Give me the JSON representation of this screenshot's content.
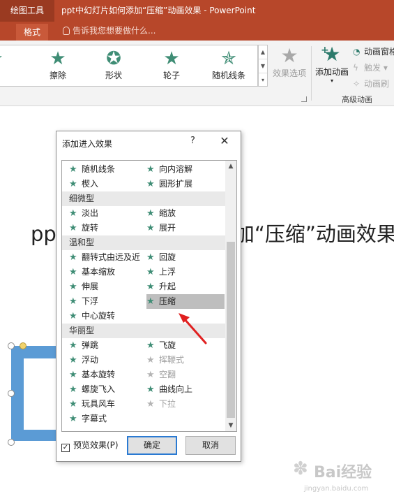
{
  "titlebar": {
    "tool_label": "绘图工具",
    "doc_title": "ppt中幻灯片如何添加“压缩”动画效果 - PowerPoint"
  },
  "tabs": {
    "format": "格式",
    "tell_me": "告诉我您想要做什么..."
  },
  "ribbon": {
    "gallery": [
      "裂",
      "擦除",
      "形状",
      "轮子",
      "随机线条"
    ],
    "effect_options": "效果选项",
    "add_animation": "添加动画",
    "animation_pane": "动画窗格",
    "trigger": "触发",
    "animation_painter": "动画刷",
    "group_label": "高级动画"
  },
  "slide": {
    "title_left": "pp",
    "title_right": "加“压缩”动画效果"
  },
  "dialog": {
    "title": "添加进入效果",
    "help": "?",
    "close": "✕",
    "rows": [
      {
        "type": "effects",
        "left": "随机线条",
        "right": "向内溶解"
      },
      {
        "type": "effects",
        "left": "楔入",
        "right": "圆形扩展"
      },
      {
        "type": "category",
        "label": "细微型"
      },
      {
        "type": "effects",
        "left": "淡出",
        "right": "缩放"
      },
      {
        "type": "effects",
        "left": "旋转",
        "right": "展开"
      },
      {
        "type": "category",
        "label": "温和型"
      },
      {
        "type": "effects",
        "left": "翻转式由远及近",
        "right": "回旋"
      },
      {
        "type": "effects",
        "left": "基本缩放",
        "right": "上浮"
      },
      {
        "type": "effects",
        "left": "伸展",
        "right": "升起"
      },
      {
        "type": "effects",
        "left": "下浮",
        "right": "压缩",
        "right_selected": true
      },
      {
        "type": "effects",
        "left": "中心旋转",
        "right": ""
      },
      {
        "type": "category",
        "label": "华丽型"
      },
      {
        "type": "effects",
        "left": "弹跳",
        "right": "飞旋"
      },
      {
        "type": "effects",
        "left": "浮动",
        "right": "挥鞭式",
        "right_disabled": true
      },
      {
        "type": "effects",
        "left": "基本旋转",
        "right": "空翻",
        "right_disabled": true
      },
      {
        "type": "effects",
        "left": "螺旋飞入",
        "right": "曲线向上"
      },
      {
        "type": "effects",
        "left": "玩具风车",
        "right": "下拉",
        "right_disabled": true
      },
      {
        "type": "effects",
        "left": "字幕式",
        "right": ""
      }
    ],
    "preview_label": "预览效果(P)",
    "preview_checked": true,
    "ok": "确定",
    "cancel": "取消"
  },
  "watermark": {
    "text": "Bai经验",
    "url": "jingyan.baidu.com"
  }
}
